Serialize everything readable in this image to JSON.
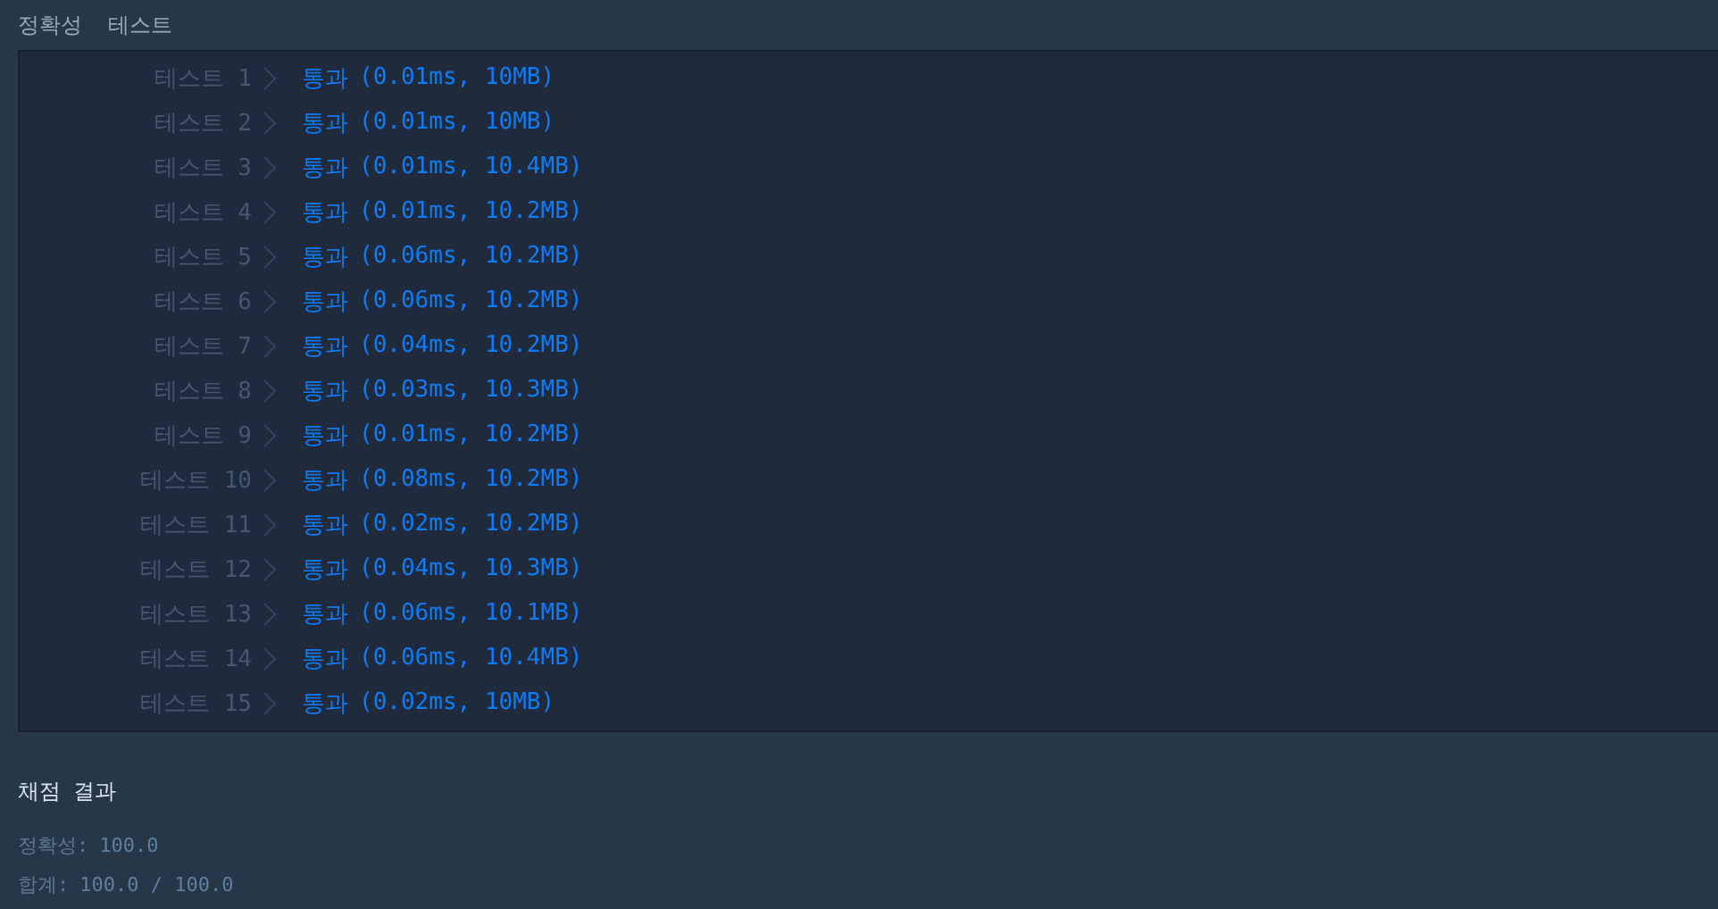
{
  "section_title": "정확성  테스트",
  "tests": [
    {
      "label": "테스트 1",
      "result": "통과",
      "detail": "(0.01ms, 10MB)"
    },
    {
      "label": "테스트 2",
      "result": "통과",
      "detail": "(0.01ms, 10MB)"
    },
    {
      "label": "테스트 3",
      "result": "통과",
      "detail": "(0.01ms, 10.4MB)"
    },
    {
      "label": "테스트 4",
      "result": "통과",
      "detail": "(0.01ms, 10.2MB)"
    },
    {
      "label": "테스트 5",
      "result": "통과",
      "detail": "(0.06ms, 10.2MB)"
    },
    {
      "label": "테스트 6",
      "result": "통과",
      "detail": "(0.06ms, 10.2MB)"
    },
    {
      "label": "테스트 7",
      "result": "통과",
      "detail": "(0.04ms, 10.2MB)"
    },
    {
      "label": "테스트 8",
      "result": "통과",
      "detail": "(0.03ms, 10.3MB)"
    },
    {
      "label": "테스트 9",
      "result": "통과",
      "detail": "(0.01ms, 10.2MB)"
    },
    {
      "label": "테스트 10",
      "result": "통과",
      "detail": "(0.08ms, 10.2MB)"
    },
    {
      "label": "테스트 11",
      "result": "통과",
      "detail": "(0.02ms, 10.2MB)"
    },
    {
      "label": "테스트 12",
      "result": "통과",
      "detail": "(0.04ms, 10.3MB)"
    },
    {
      "label": "테스트 13",
      "result": "통과",
      "detail": "(0.06ms, 10.1MB)"
    },
    {
      "label": "테스트 14",
      "result": "통과",
      "detail": "(0.06ms, 10.4MB)"
    },
    {
      "label": "테스트 15",
      "result": "통과",
      "detail": "(0.02ms, 10MB)"
    }
  ],
  "summary": {
    "title": "채점 결과",
    "lines": [
      {
        "label": "정확성:",
        "value": "100.0"
      },
      {
        "label": "합계:",
        "value": "100.0 / 100.0"
      }
    ]
  }
}
